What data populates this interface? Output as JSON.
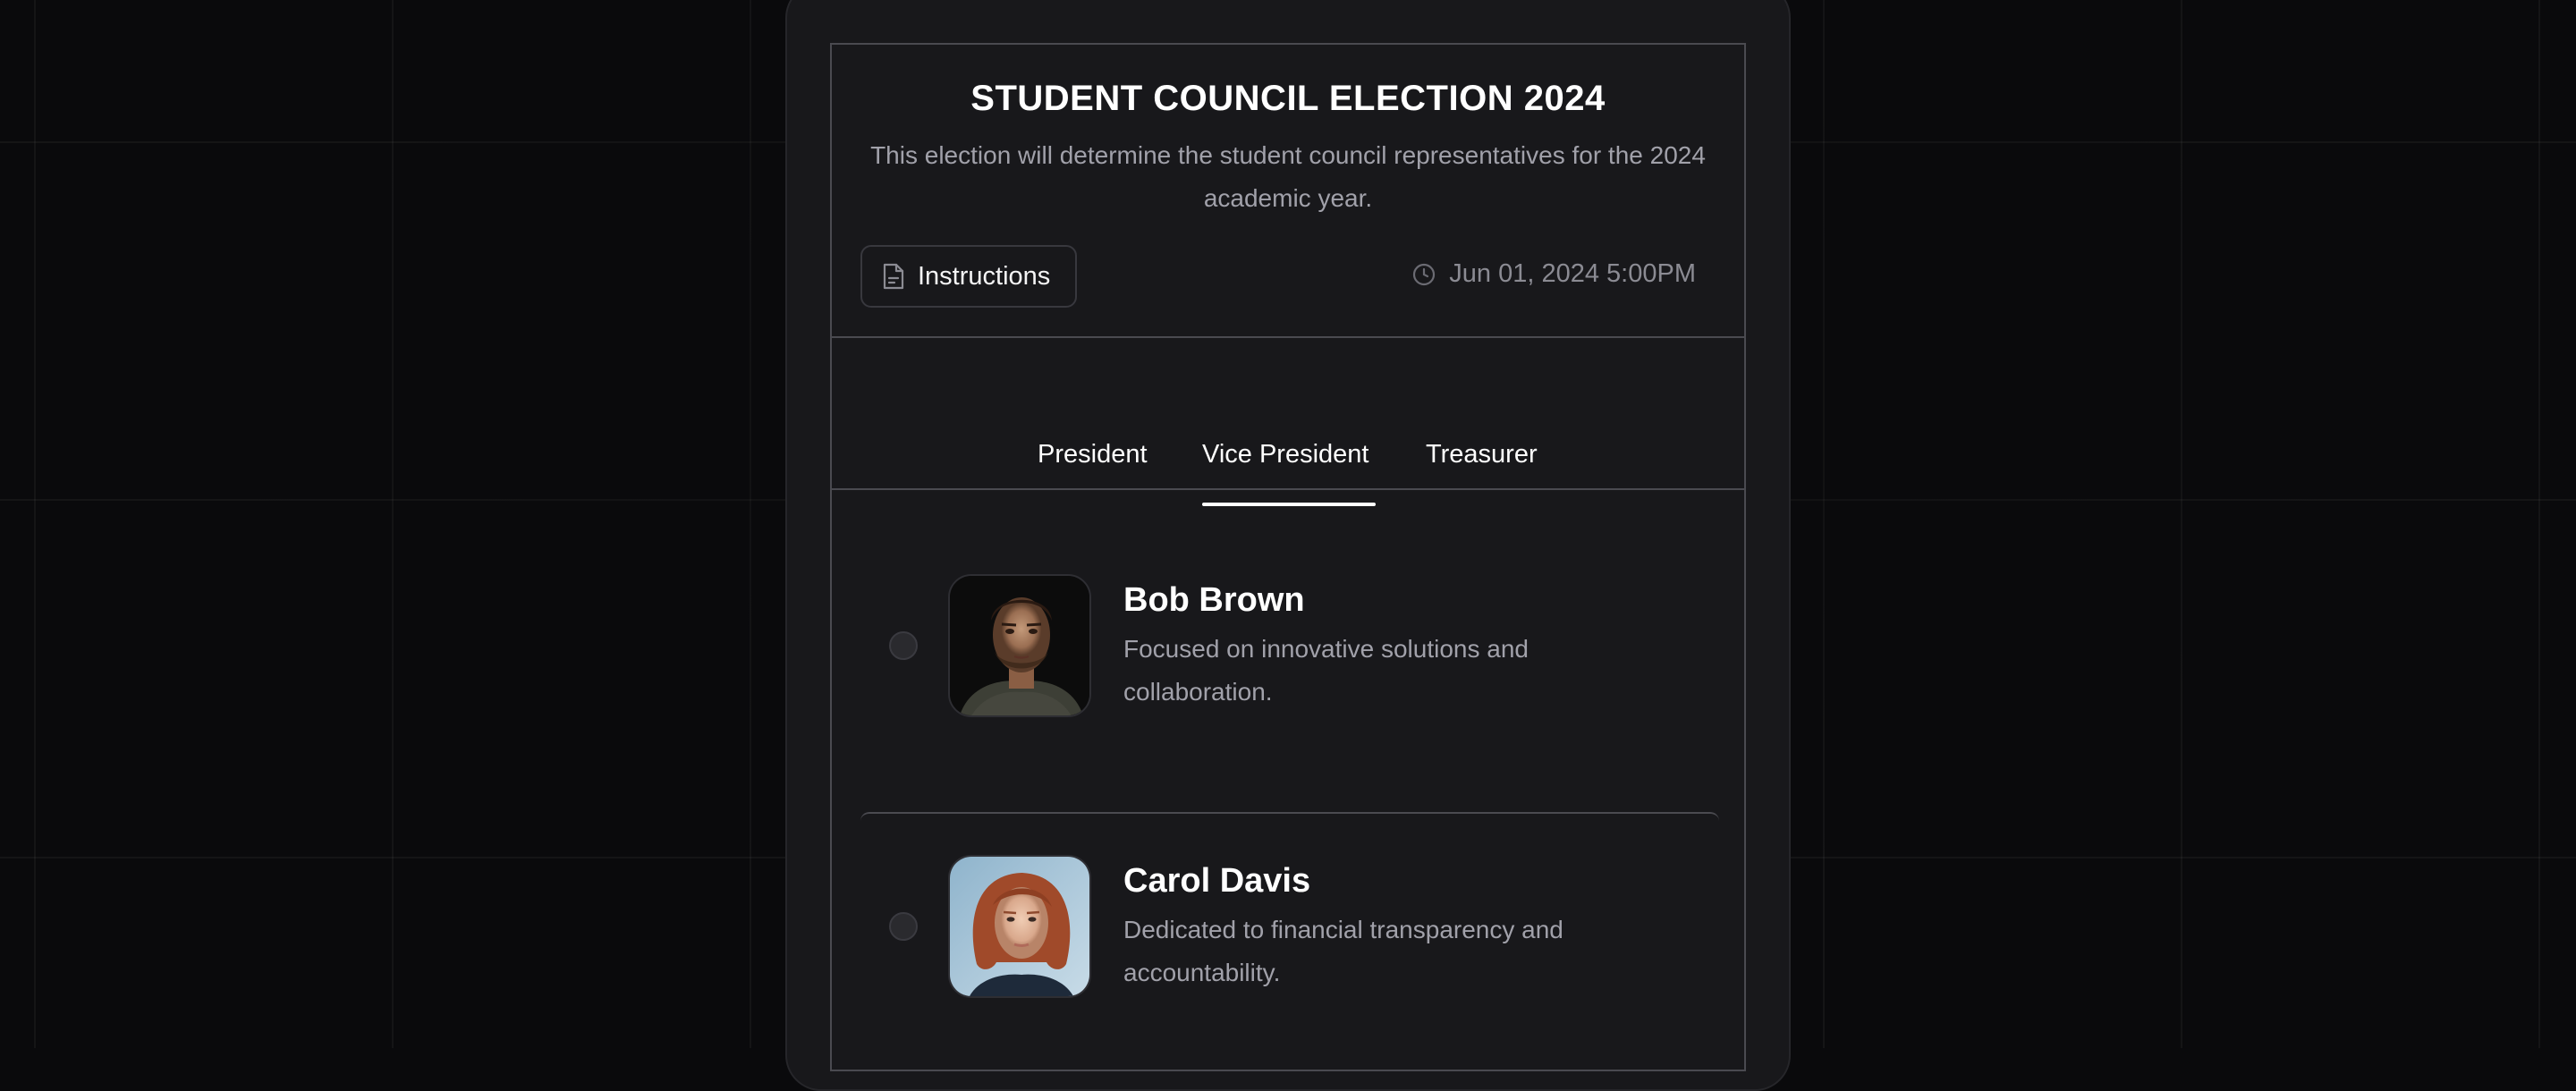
{
  "election": {
    "title": "STUDENT COUNCIL ELECTION 2024",
    "description": "This election will determine the student council representatives for the 2024 academic year.",
    "instructions_label": "Instructions",
    "datetime": "Jun 01, 2024 5:00PM"
  },
  "tabs": [
    {
      "label": "President",
      "active": false
    },
    {
      "label": "Vice President",
      "active": true
    },
    {
      "label": "Treasurer",
      "active": false
    }
  ],
  "candidates": [
    {
      "name": "Bob Brown",
      "description": "Focused on innovative solutions and collaboration.",
      "selected": false
    },
    {
      "name": "Carol Davis",
      "description": "Dedicated to financial transparency and accountability.",
      "selected": false
    }
  ],
  "icons": {
    "instructions": "document-icon",
    "datetime": "clock-icon"
  },
  "colors": {
    "background": "#0a0a0c",
    "card": "#18181b",
    "border": "#4a4a50",
    "muted_text": "#a1a1aa",
    "active_tab_underline": "#ffffff"
  }
}
